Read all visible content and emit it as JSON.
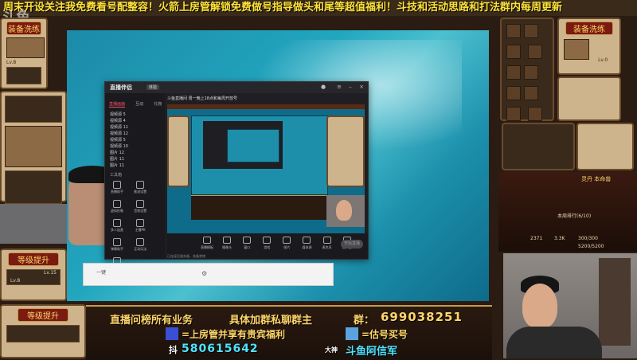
{
  "watermark": "斗鱼",
  "marquee_text": "周末开设关注我免费看号配整容！火箭上房管解锁免费做号指导做头和尾等超值福利！斗技和活动思路和打法群内每周更新",
  "game_left": {
    "banner_top": "装备洗练",
    "level_up_1": "等级提升",
    "level_up_2": "等级提升",
    "lv_from": "Lv.8",
    "lv_to": "Lv.15"
  },
  "game_right": {
    "banner_top": "装备洗练",
    "lv_label": "Lv.0",
    "ranking": "本周排行(6/10)",
    "tag": "灵丹 本命兽",
    "stat_a": "2371",
    "stat_b": "3.3K",
    "stat_c": "300/300",
    "stat_d": "5200/5200"
  },
  "app": {
    "logo": "直播伴侣",
    "badge": "体验",
    "room_title": "斗鱼直播间 周一晚上18点和每周开放号",
    "tabs": [
      "直播画面",
      "互动",
      "礼物"
    ],
    "sources": [
      "视频源 5",
      "视频源 4",
      "视频源 11",
      "视频源 12",
      "视频源 5",
      "视频源 10",
      "图片 12",
      "图片 11",
      "图片 11"
    ],
    "tools_header": "工具箱",
    "tools": [
      "直播助手",
      "推流设置",
      "虚拟形象",
      "音效设置",
      "多人连麦",
      "主播PK",
      "弹幕助手",
      "互动玩法",
      "更多"
    ],
    "bottom_tools": [
      "直播模板",
      "摄像头",
      "窗口",
      "游戏",
      "图片",
      "媒体源",
      "麦克风",
      "扬声器"
    ],
    "go_live": "开始直播",
    "status": "已连接至服务器，准备就绪"
  },
  "browser_strip": {
    "btn_label": "一键",
    "icon": "settings-gear"
  },
  "info_panel": {
    "line1_left": "直播问榜所有业务",
    "line1_mid": "具体加群私聊群主",
    "line1_right_prefix": "群：",
    "group_number": "699038251",
    "line2_left": "=上房管并享有贵宾福利",
    "line2_right": "=估号买号",
    "tiktok_label": "抖",
    "tiktok_number": "580615642",
    "douyu_prefix": "大神",
    "douyu_name": "斗鱼阿信军"
  },
  "colors": {
    "marquee": "#ffe33a",
    "accent_red": "#ff4d6b",
    "gold": "#ffd56a",
    "cyan_text": "#4fe3ff"
  }
}
